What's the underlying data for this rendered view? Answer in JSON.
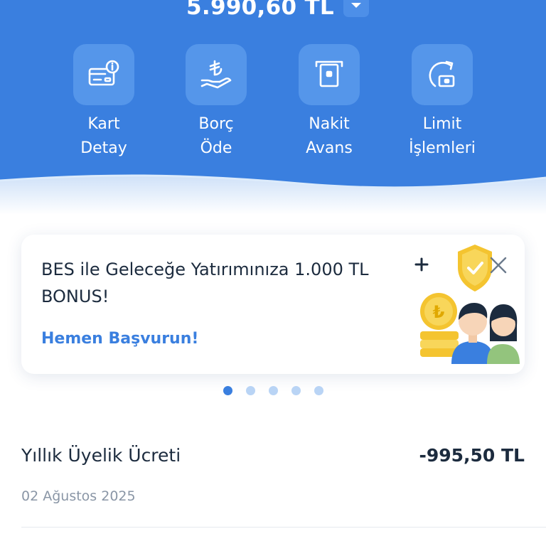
{
  "balance": {
    "amount": "5.990,60 TL",
    "toggle_icon": "chevron-down-icon"
  },
  "actions": [
    {
      "label_line1": "Kart",
      "label_line2": "Detay",
      "icon": "card-info-icon"
    },
    {
      "label_line1": "Borç",
      "label_line2": "Öde",
      "icon": "lira-hand-icon"
    },
    {
      "label_line1": "Nakit",
      "label_line2": "Avans",
      "icon": "atm-cash-icon"
    },
    {
      "label_line1": "Limit",
      "label_line2": "İşlemleri",
      "icon": "limit-refresh-icon"
    }
  ],
  "promo": {
    "title": "BES ile Geleceğe Yatırımınıza 1.000 TL BONUS!",
    "link": "Hemen Başvurun!",
    "close_icon": "close-icon",
    "illustration": "bes-family-illustration"
  },
  "carousel": {
    "count": 5,
    "active_index": 0
  },
  "transaction": {
    "title": "Yıllık Üyelik Ücreti",
    "amount": "-995,50 TL",
    "date": "02 Ağustos 2025"
  },
  "colors": {
    "brand_blue": "#3a7fdf",
    "tile_blue": "#5596ea",
    "text_dark": "#1c2b3e",
    "text_muted": "#8a96a6",
    "dot_inactive": "#b9d4f5"
  }
}
